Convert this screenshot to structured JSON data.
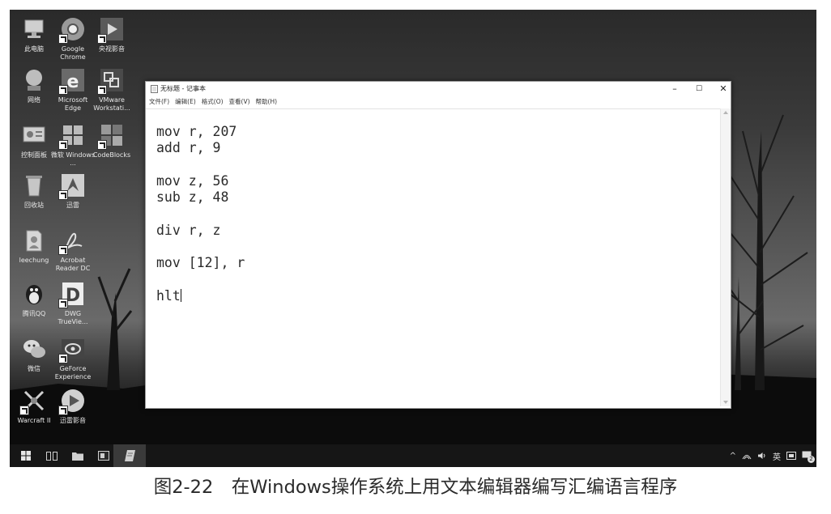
{
  "desktop": {
    "icons": [
      {
        "label": "此电脑",
        "icon": "computer-icon"
      },
      {
        "label": "Google Chrome",
        "icon": "chrome-icon"
      },
      {
        "label": "央视影音",
        "icon": "video-player-icon"
      },
      {
        "label": "网络",
        "icon": "network-icon"
      },
      {
        "label": "Microsoft Edge",
        "icon": "edge-icon"
      },
      {
        "label": "VMware Workstati...",
        "icon": "vmware-icon"
      },
      {
        "label": "控制面板",
        "icon": "control-panel-icon"
      },
      {
        "label": "微软 Windows ...",
        "icon": "windows-logo-icon"
      },
      {
        "label": "CodeBlocks",
        "icon": "codeblocks-icon"
      },
      {
        "label": "回收站",
        "icon": "recycle-bin-icon"
      },
      {
        "label": "迅雷",
        "icon": "thunder-icon"
      },
      {
        "label": "leechung",
        "icon": "user-folder-icon"
      },
      {
        "label": "Acrobat Reader DC",
        "icon": "acrobat-icon"
      },
      {
        "label": "腾讯QQ",
        "icon": "qq-penguin-icon"
      },
      {
        "label": "DWG TrueVie...",
        "icon": "dwg-icon"
      },
      {
        "label": "微信",
        "icon": "wechat-icon"
      },
      {
        "label": "GeForce Experience",
        "icon": "geforce-icon"
      },
      {
        "label": "Warcraft II",
        "icon": "warcraft-icon"
      },
      {
        "label": "迅雷影音",
        "icon": "thunder-player-icon"
      }
    ]
  },
  "notepad": {
    "title": "无标题 - 记事本",
    "controls": {
      "minimize": "–",
      "maximize": "☐",
      "close": "✕"
    },
    "menu": [
      "文件(F)",
      "编辑(E)",
      "格式(O)",
      "查看(V)",
      "帮助(H)"
    ],
    "lines": [
      "mov r, 207",
      "add r, 9",
      "",
      "mov z, 56",
      "sub z, 48",
      "",
      "div r, z",
      "",
      "mov [12], r",
      "",
      "hlt"
    ]
  },
  "taskbar": {
    "buttons": [
      "start-button",
      "task-view-button",
      "file-explorer-button",
      "app-button",
      "notepad-button"
    ],
    "tray": {
      "chevron": "^",
      "ime": "英",
      "notification_count": "2"
    }
  },
  "caption": "图2-22　在Windows操作系统上用文本编辑器编写汇编语言程序"
}
